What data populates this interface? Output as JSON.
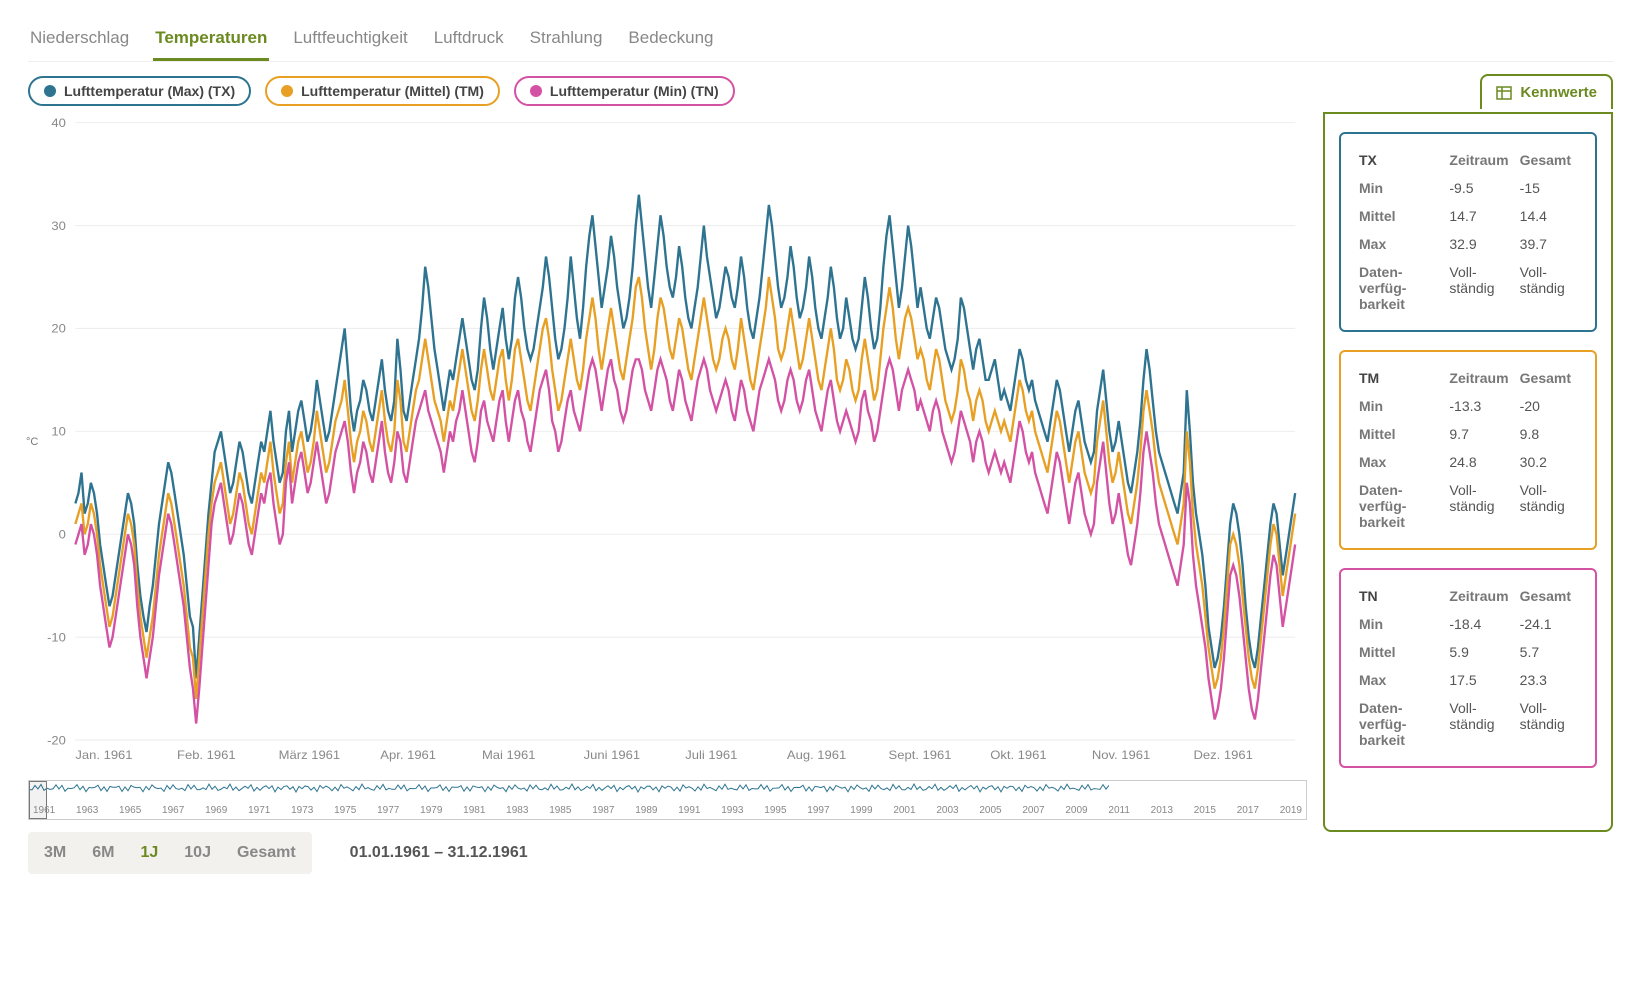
{
  "tabs": [
    "Niederschlag",
    "Temperaturen",
    "Luftfeuchtigkeit",
    "Luftdruck",
    "Strahlung",
    "Bedeckung"
  ],
  "tabs_active_index": 1,
  "legend": [
    {
      "key": "tx",
      "label": "Lufttemperatur (Max) (TX)",
      "color": "#2e7491"
    },
    {
      "key": "tm",
      "label": "Lufttemperatur (Mittel) (TM)",
      "color": "#e7a024"
    },
    {
      "key": "tn",
      "label": "Lufttemperatur (Min) (TN)",
      "color": "#d352a3"
    }
  ],
  "kennwerte_label": "Kennwerte",
  "stats": {
    "headers": [
      "Zeitraum",
      "Gesamt"
    ],
    "rows_labels": [
      "Min",
      "Mittel",
      "Max",
      "Daten­verfüg­barkeit"
    ],
    "tx": {
      "title": "TX",
      "min": [
        "-9.5",
        "-15"
      ],
      "mittel": [
        "14.7",
        "14.4"
      ],
      "max": [
        "32.9",
        "39.7"
      ],
      "avail": [
        "Voll­ständig",
        "Voll­ständig"
      ]
    },
    "tm": {
      "title": "TM",
      "min": [
        "-13.3",
        "-20"
      ],
      "mittel": [
        "9.7",
        "9.8"
      ],
      "max": [
        "24.8",
        "30.2"
      ],
      "avail": [
        "Voll­ständig",
        "Voll­ständig"
      ]
    },
    "tn": {
      "title": "TN",
      "min": [
        "-18.4",
        "-24.1"
      ],
      "mittel": [
        "5.9",
        "5.7"
      ],
      "max": [
        "17.5",
        "23.3"
      ],
      "avail": [
        "Voll­ständig",
        "Voll­ständig"
      ]
    }
  },
  "y_axis_label": "°C",
  "y_ticks": [
    -20,
    -10,
    0,
    10,
    20,
    30,
    40
  ],
  "x_ticks": [
    "Jan. 1961",
    "Feb. 1961",
    "März 1961",
    "Apr. 1961",
    "Mai 1961",
    "Juni 1961",
    "Juli 1961",
    "Aug. 1961",
    "Sept. 1961",
    "Okt. 1961",
    "Nov. 1961",
    "Dez. 1961"
  ],
  "overview_years": [
    "1961",
    "1963",
    "1965",
    "1967",
    "1969",
    "1971",
    "1973",
    "1975",
    "1977",
    "1979",
    "1981",
    "1983",
    "1985",
    "1987",
    "1989",
    "1991",
    "1993",
    "1995",
    "1997",
    "1999",
    "2001",
    "2003",
    "2005",
    "2007",
    "2009",
    "2011",
    "2013",
    "2015",
    "2017",
    "2019"
  ],
  "range_buttons": [
    "3M",
    "6M",
    "1J",
    "10J",
    "Gesamt"
  ],
  "range_active_index": 2,
  "range_text": "01.01.1961 – 31.12.1961",
  "chart_data": {
    "type": "line",
    "title": "",
    "xlabel": "",
    "ylabel": "°C",
    "ylim": [
      -20,
      40
    ],
    "x_domain": [
      1,
      365
    ],
    "series": [
      {
        "name": "Lufttemperatur (Max) (TX)",
        "key": "tx",
        "color": "#2e7491",
        "values": [
          3,
          4,
          6,
          2,
          3,
          5,
          4,
          2,
          -1,
          -3,
          -5,
          -7,
          -6,
          -4,
          -2,
          0,
          2,
          4,
          3,
          1,
          -3,
          -6,
          -8,
          -9.5,
          -7,
          -5,
          -2,
          1,
          3,
          5,
          7,
          6,
          4,
          2,
          0,
          -2,
          -5,
          -8,
          -9,
          -14,
          -10,
          -6,
          -2,
          2,
          5,
          8,
          9,
          10,
          8,
          6,
          4,
          5,
          7,
          9,
          8,
          6,
          4,
          3,
          5,
          7,
          9,
          8,
          10,
          12,
          9,
          7,
          5,
          6,
          10,
          12,
          8,
          10,
          12,
          13,
          11,
          9,
          10,
          12,
          15,
          13,
          11,
          9,
          10,
          12,
          14,
          16,
          18,
          20,
          16,
          12,
          10,
          12,
          13,
          15,
          14,
          12,
          11,
          13,
          15,
          17,
          14,
          12,
          11,
          13,
          19,
          16,
          12,
          11,
          13,
          15,
          17,
          19,
          22,
          26,
          24,
          21,
          18,
          16,
          14,
          12,
          14,
          16,
          15,
          17,
          19,
          21,
          19,
          17,
          15,
          14,
          16,
          20,
          23,
          21,
          18,
          16,
          18,
          20,
          22,
          19,
          17,
          19,
          23,
          25,
          23,
          20,
          18,
          17,
          18,
          20,
          22,
          24,
          27,
          25,
          22,
          19,
          17,
          18,
          20,
          23,
          27,
          24,
          21,
          19,
          22,
          26,
          29,
          31,
          28,
          25,
          22,
          24,
          26,
          29,
          27,
          24,
          22,
          20,
          21,
          23,
          26,
          30,
          33,
          30,
          27,
          24,
          22,
          25,
          28,
          31,
          29,
          26,
          24,
          23,
          25,
          28,
          26,
          23,
          21,
          20,
          22,
          24,
          27,
          30,
          27,
          25,
          23,
          21,
          22,
          24,
          26,
          25,
          23,
          22,
          24,
          27,
          25,
          22,
          20,
          19,
          21,
          23,
          26,
          29,
          32,
          30,
          27,
          24,
          22,
          23,
          25,
          28,
          26,
          23,
          21,
          22,
          24,
          27,
          25,
          22,
          20,
          19,
          21,
          23,
          26,
          24,
          21,
          19,
          20,
          23,
          21,
          19,
          18,
          19,
          22,
          25,
          23,
          20,
          18,
          19,
          22,
          26,
          29,
          31,
          28,
          25,
          22,
          24,
          27,
          30,
          28,
          25,
          22,
          24,
          22,
          20,
          19,
          21,
          23,
          22,
          20,
          18,
          17,
          16,
          17,
          19,
          23,
          22,
          20,
          18,
          16,
          18,
          19,
          17,
          15,
          15,
          16,
          17,
          15,
          13,
          14,
          13,
          12,
          14,
          16,
          18,
          17,
          15,
          14,
          15,
          13,
          12,
          11,
          10,
          9,
          11,
          13,
          15,
          14,
          12,
          10,
          8,
          10,
          12,
          13,
          11,
          9,
          8,
          7,
          8,
          12,
          14,
          16,
          13,
          10,
          8,
          9,
          11,
          9,
          7,
          5,
          4,
          6,
          8,
          11,
          15,
          18,
          16,
          13,
          10,
          8,
          7,
          6,
          5,
          4,
          3,
          2,
          4,
          6,
          14,
          10,
          5,
          2,
          0,
          -2,
          -5,
          -9,
          -11,
          -13,
          -12,
          -10,
          -7,
          -3,
          1,
          3,
          2,
          0,
          -3,
          -7,
          -10,
          -12,
          -13,
          -11,
          -8,
          -5,
          -2,
          1,
          3,
          2,
          -1,
          -4,
          -2,
          0,
          2,
          4
        ]
      },
      {
        "name": "Lufttemperatur (Mittel) (TM)",
        "key": "tm",
        "color": "#e7a024",
        "values": [
          1,
          2,
          3,
          0,
          1,
          3,
          2,
          0,
          -3,
          -5,
          -7,
          -9,
          -8,
          -6,
          -4,
          -2,
          0,
          2,
          1,
          -1,
          -5,
          -8,
          -10,
          -12,
          -10,
          -8,
          -5,
          -2,
          0,
          2,
          4,
          3,
          1,
          -1,
          -3,
          -5,
          -8,
          -11,
          -12,
          -16,
          -12,
          -8,
          -4,
          0,
          3,
          5,
          6,
          7,
          5,
          3,
          1,
          2,
          4,
          6,
          5,
          3,
          1,
          0,
          2,
          4,
          6,
          5,
          7,
          9,
          6,
          4,
          2,
          3,
          7,
          9,
          5,
          7,
          9,
          10,
          8,
          6,
          7,
          9,
          12,
          10,
          8,
          6,
          7,
          9,
          11,
          12,
          13,
          15,
          12,
          9,
          7,
          9,
          10,
          12,
          11,
          9,
          8,
          10,
          12,
          14,
          11,
          9,
          8,
          10,
          15,
          13,
          9,
          8,
          10,
          12,
          14,
          15,
          17,
          19,
          17,
          15,
          13,
          12,
          11,
          9,
          11,
          13,
          12,
          14,
          16,
          18,
          16,
          14,
          12,
          11,
          13,
          16,
          18,
          16,
          14,
          13,
          15,
          17,
          18,
          15,
          13,
          15,
          18,
          19,
          17,
          15,
          13,
          12,
          14,
          16,
          18,
          20,
          21,
          19,
          16,
          14,
          12,
          13,
          15,
          17,
          19,
          17,
          15,
          14,
          16,
          19,
          21,
          23,
          21,
          18,
          16,
          18,
          20,
          22,
          20,
          18,
          16,
          15,
          17,
          19,
          21,
          24,
          25,
          23,
          20,
          18,
          16,
          18,
          21,
          23,
          22,
          20,
          18,
          17,
          19,
          21,
          20,
          18,
          16,
          15,
          17,
          19,
          21,
          23,
          21,
          19,
          17,
          16,
          17,
          19,
          20,
          19,
          17,
          16,
          18,
          21,
          19,
          17,
          15,
          14,
          16,
          18,
          20,
          22,
          25,
          23,
          21,
          18,
          17,
          18,
          20,
          22,
          20,
          18,
          16,
          17,
          19,
          21,
          19,
          17,
          15,
          14,
          16,
          18,
          20,
          18,
          15,
          14,
          15,
          17,
          16,
          14,
          13,
          14,
          17,
          19,
          17,
          15,
          13,
          14,
          17,
          20,
          22,
          24,
          22,
          19,
          17,
          19,
          21,
          22,
          21,
          19,
          17,
          18,
          17,
          15,
          14,
          16,
          18,
          17,
          15,
          13,
          12,
          11,
          12,
          14,
          17,
          16,
          14,
          13,
          11,
          13,
          14,
          13,
          11,
          10,
          11,
          12,
          11,
          10,
          11,
          10,
          9,
          11,
          13,
          15,
          14,
          12,
          11,
          12,
          10,
          9,
          8,
          7,
          6,
          8,
          10,
          12,
          11,
          9,
          7,
          5,
          7,
          9,
          10,
          8,
          6,
          5,
          4,
          5,
          9,
          11,
          13,
          10,
          7,
          5,
          6,
          8,
          6,
          4,
          2,
          1,
          3,
          5,
          8,
          12,
          14,
          12,
          10,
          7,
          5,
          4,
          3,
          2,
          1,
          0,
          -1,
          1,
          3,
          10,
          7,
          2,
          -1,
          -3,
          -5,
          -8,
          -11,
          -13,
          -15,
          -14,
          -12,
          -9,
          -5,
          -1,
          0,
          -1,
          -3,
          -6,
          -9,
          -12,
          -14,
          -15,
          -13,
          -10,
          -7,
          -4,
          -1,
          1,
          0,
          -3,
          -6,
          -4,
          -2,
          0,
          2
        ]
      },
      {
        "name": "Lufttemperatur (Min) (TN)",
        "key": "tn",
        "color": "#d352a3",
        "values": [
          -1,
          0,
          1,
          -2,
          -1,
          1,
          0,
          -2,
          -5,
          -7,
          -9,
          -11,
          -10,
          -8,
          -6,
          -4,
          -2,
          0,
          -1,
          -3,
          -7,
          -10,
          -12,
          -14,
          -12,
          -10,
          -7,
          -4,
          -2,
          0,
          2,
          1,
          -1,
          -3,
          -5,
          -7,
          -10,
          -13,
          -15,
          -18.4,
          -15,
          -11,
          -7,
          -3,
          1,
          3,
          4,
          5,
          3,
          1,
          -1,
          0,
          2,
          4,
          3,
          1,
          -1,
          -2,
          0,
          2,
          4,
          3,
          5,
          6,
          3,
          1,
          -1,
          0,
          5,
          7,
          3,
          5,
          7,
          8,
          6,
          4,
          5,
          7,
          9,
          7,
          5,
          3,
          4,
          6,
          8,
          9,
          10,
          11,
          9,
          6,
          4,
          6,
          7,
          9,
          8,
          6,
          5,
          7,
          9,
          11,
          8,
          6,
          5,
          7,
          10,
          9,
          6,
          5,
          7,
          9,
          11,
          12,
          13,
          14,
          12,
          11,
          10,
          9,
          8,
          6,
          8,
          10,
          9,
          11,
          12,
          14,
          12,
          10,
          8,
          7,
          9,
          12,
          13,
          11,
          10,
          9,
          11,
          13,
          14,
          11,
          9,
          11,
          13,
          14,
          12,
          11,
          9,
          8,
          10,
          12,
          14,
          15,
          16,
          14,
          11,
          10,
          8,
          9,
          11,
          13,
          14,
          12,
          11,
          10,
          12,
          14,
          16,
          17,
          16,
          14,
          12,
          14,
          16,
          17,
          15,
          14,
          12,
          11,
          12,
          14,
          16,
          17,
          17,
          16,
          14,
          13,
          12,
          14,
          16,
          17,
          16,
          15,
          13,
          12,
          14,
          16,
          15,
          13,
          12,
          11,
          13,
          15,
          16,
          17,
          16,
          14,
          13,
          12,
          13,
          14,
          15,
          14,
          12,
          11,
          13,
          15,
          14,
          12,
          11,
          10,
          12,
          14,
          15,
          16,
          17,
          16,
          15,
          13,
          12,
          13,
          15,
          16,
          15,
          13,
          12,
          13,
          15,
          16,
          14,
          12,
          11,
          10,
          12,
          14,
          15,
          13,
          11,
          10,
          11,
          12,
          11,
          10,
          9,
          10,
          13,
          14,
          12,
          11,
          9,
          10,
          12,
          14,
          16,
          17,
          16,
          14,
          12,
          14,
          15,
          16,
          15,
          14,
          12,
          13,
          12,
          11,
          10,
          12,
          13,
          12,
          10,
          9,
          8,
          7,
          8,
          10,
          12,
          11,
          10,
          9,
          7,
          9,
          10,
          9,
          7,
          6,
          7,
          8,
          7,
          6,
          7,
          6,
          5,
          7,
          9,
          11,
          10,
          8,
          7,
          8,
          6,
          5,
          4,
          3,
          2,
          4,
          6,
          8,
          7,
          5,
          3,
          1,
          3,
          5,
          6,
          4,
          2,
          1,
          0,
          1,
          5,
          7,
          9,
          6,
          3,
          1,
          2,
          4,
          2,
          0,
          -2,
          -3,
          -1,
          1,
          4,
          8,
          10,
          8,
          6,
          3,
          1,
          0,
          -1,
          -2,
          -3,
          -4,
          -5,
          -3,
          -1,
          5,
          3,
          -2,
          -5,
          -7,
          -9,
          -11,
          -14,
          -16,
          -18,
          -17,
          -15,
          -12,
          -8,
          -4,
          -3,
          -4,
          -6,
          -9,
          -12,
          -15,
          -17,
          -18,
          -16,
          -13,
          -10,
          -7,
          -4,
          -2,
          -3,
          -6,
          -9,
          -7,
          -5,
          -3,
          -1
        ]
      }
    ]
  }
}
